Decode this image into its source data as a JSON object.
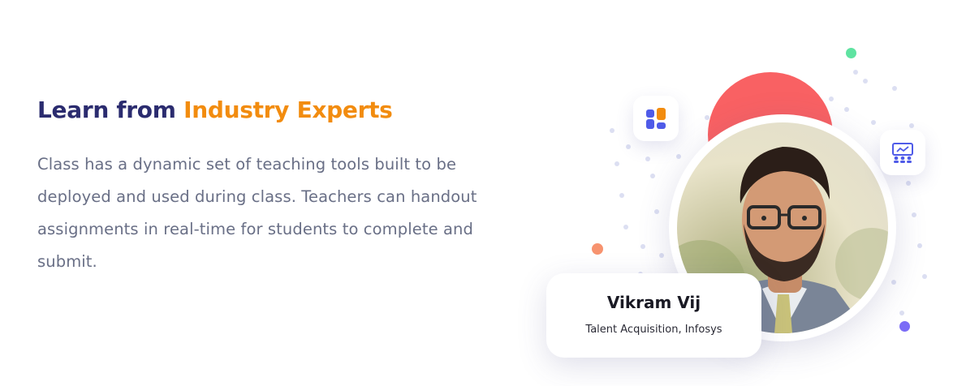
{
  "heading": {
    "prefix": "Learn from",
    "highlight": "Industry Experts"
  },
  "description": "Class has a dynamic set of teaching tools built to be deployed and used during class. Teachers can handout assignments in real-time for students to complete and submit.",
  "expert": {
    "name": "Vikram Vij",
    "role": "Talent Acquisition, Infosys"
  },
  "colors": {
    "heading_dark": "#2b2c6f",
    "heading_accent": "#f28c0f",
    "body_text": "#696f86",
    "red_circle": "#f96163",
    "dot_green": "#5fe3a1",
    "dot_orange": "#f7936f",
    "dot_purple": "#7b6cf6",
    "icon_blue": "#4f5be8",
    "icon_orange": "#f28c0f"
  },
  "icons": {
    "left_tile": "dashboard-blocks-icon",
    "right_tile": "classroom-icon"
  }
}
